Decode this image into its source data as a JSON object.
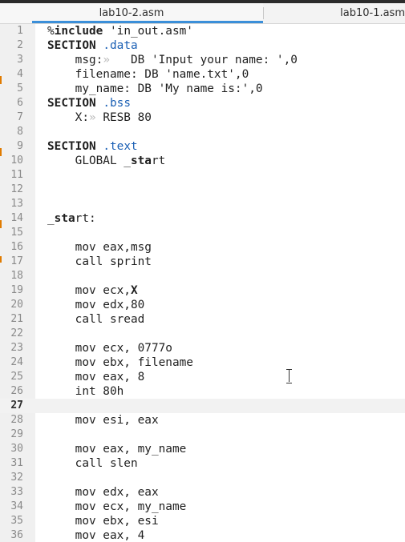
{
  "tabs": [
    {
      "label": "lab10-2.asm",
      "active": true
    },
    {
      "label": "lab10-1.asm",
      "active": false
    }
  ],
  "editor": {
    "current_line": 27,
    "lines": [
      {
        "n": "1",
        "t": "%include 'in_out.asm'"
      },
      {
        "n": "2",
        "t": "SECTION .data"
      },
      {
        "n": "3",
        "t": "    msg:»   DB 'Input your name: ',0"
      },
      {
        "n": "4",
        "t": "    filename: DB 'name.txt',0"
      },
      {
        "n": "5",
        "t": "    my_name: DB 'My name is:',0"
      },
      {
        "n": "6",
        "t": "SECTION .bss"
      },
      {
        "n": "7",
        "t": "    X:» RESB 80"
      },
      {
        "n": "8",
        "t": ""
      },
      {
        "n": "9",
        "t": "SECTION .text"
      },
      {
        "n": "10",
        "t": "    GLOBAL _start"
      },
      {
        "n": "11",
        "t": ""
      },
      {
        "n": "12",
        "t": ""
      },
      {
        "n": "13",
        "t": ""
      },
      {
        "n": "14",
        "t": "_start:"
      },
      {
        "n": "15",
        "t": ""
      },
      {
        "n": "16",
        "t": "    mov eax,msg"
      },
      {
        "n": "17",
        "t": "    call sprint"
      },
      {
        "n": "18",
        "t": ""
      },
      {
        "n": "19",
        "t": "    mov ecx,X"
      },
      {
        "n": "20",
        "t": "    mov edx,80"
      },
      {
        "n": "21",
        "t": "    call sread"
      },
      {
        "n": "22",
        "t": ""
      },
      {
        "n": "23",
        "t": "    mov ecx, 0777o"
      },
      {
        "n": "24",
        "t": "    mov ebx, filename"
      },
      {
        "n": "25",
        "t": "    mov eax, 8"
      },
      {
        "n": "26",
        "t": "    int 80h"
      },
      {
        "n": "27",
        "t": ""
      },
      {
        "n": "28",
        "t": "    mov esi, eax"
      },
      {
        "n": "29",
        "t": ""
      },
      {
        "n": "30",
        "t": "    mov eax, my_name"
      },
      {
        "n": "31",
        "t": "    call slen"
      },
      {
        "n": "32",
        "t": ""
      },
      {
        "n": "33",
        "t": "    mov edx, eax"
      },
      {
        "n": "34",
        "t": "    mov ecx, my_name"
      },
      {
        "n": "35",
        "t": "    mov ebx, esi"
      },
      {
        "n": "36",
        "t": "    mov eax, 4"
      }
    ]
  }
}
